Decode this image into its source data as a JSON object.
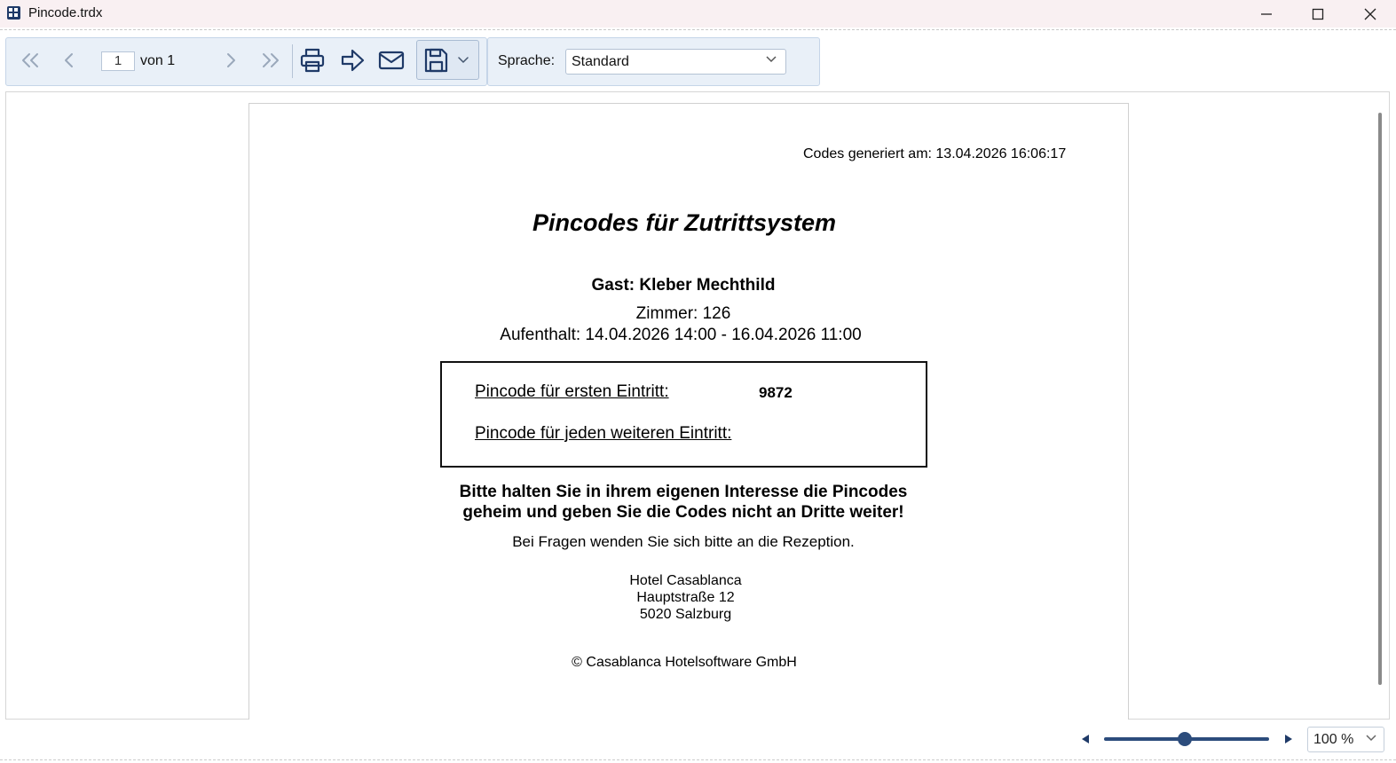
{
  "window": {
    "title": "Pincode.trdx"
  },
  "toolbar": {
    "page_current": "1",
    "page_of": "von 1",
    "language_label": "Sprache:",
    "language_value": "Standard"
  },
  "report": {
    "generated": "Codes generiert am: 13.04.2026 16:06:17",
    "title": "Pincodes für Zutrittsystem",
    "guest": "Gast: Kleber Mechthild",
    "room": "Zimmer: 126",
    "stay": "Aufenthalt: 14.04.2026 14:00 - 16.04.2026 11:00",
    "pin_first_label": "Pincode für ersten Eintritt:",
    "pin_first_value": "9872",
    "pin_further_label": "Pincode für jeden weiteren Eintritt:",
    "warning_line1": "Bitte halten Sie in ihrem eigenen Interesse die Pincodes",
    "warning_line2": "geheim und geben Sie die Codes nicht an Dritte weiter!",
    "questions": "Bei Fragen wenden Sie sich bitte an die Rezeption.",
    "hotel_name": "Hotel Casablanca",
    "hotel_street": "Hauptstraße 12",
    "hotel_city": "5020 Salzburg",
    "copyright": "© Casablanca Hotelsoftware GmbH"
  },
  "statusbar": {
    "zoom_value": "100 %",
    "zoom_level_percent": 100
  },
  "colors": {
    "accent": "#2c4c7c",
    "toolbar_bg": "#e9f0f8",
    "titlebar_bg": "#f9f0f2"
  }
}
